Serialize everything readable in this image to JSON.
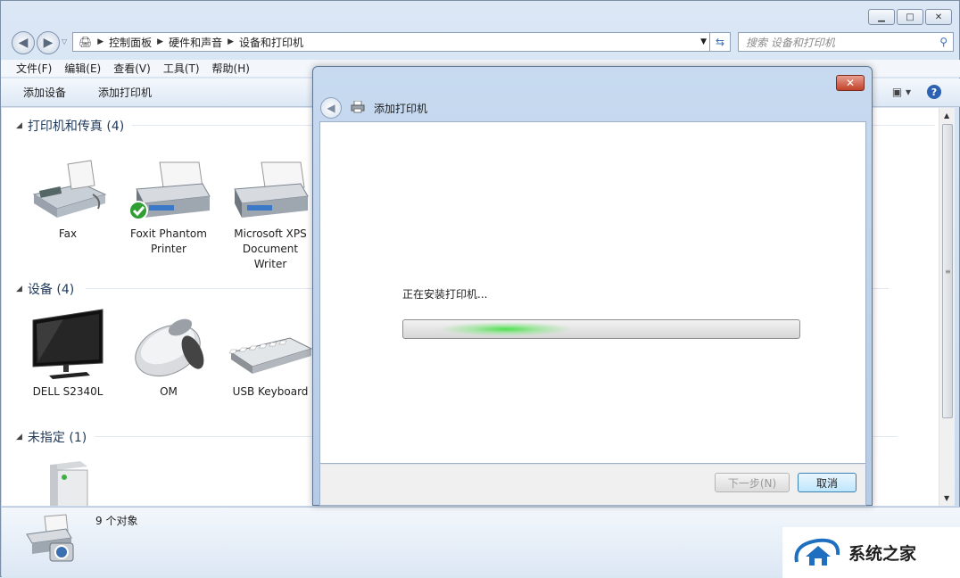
{
  "window": {
    "caption_buttons": [
      "minimize",
      "maximize",
      "close"
    ]
  },
  "nav": {
    "breadcrumb": [
      "控制面板",
      "硬件和声音",
      "设备和打印机"
    ],
    "search_placeholder": "搜索 设备和打印机"
  },
  "menu": [
    "文件(F)",
    "编辑(E)",
    "查看(V)",
    "工具(T)",
    "帮助(H)"
  ],
  "toolbar": {
    "add_device": "添加设备",
    "add_printer": "添加打印机"
  },
  "groups": {
    "printers": {
      "title": "打印机和传真 (4)",
      "items": [
        {
          "label_lines": [
            "Fax"
          ]
        },
        {
          "label_lines": [
            "Foxit Phantom",
            "Printer"
          ]
        },
        {
          "label_lines": [
            "Microsoft XPS",
            "Document",
            "Writer"
          ]
        }
      ]
    },
    "devices": {
      "title": "设备 (4)",
      "items": [
        {
          "label_lines": [
            "DELL S2340L"
          ]
        },
        {
          "label_lines": [
            "OM"
          ]
        },
        {
          "label_lines": [
            "USB Keyboard"
          ]
        }
      ]
    },
    "unspecified": {
      "title": "未指定 (1)"
    }
  },
  "status": {
    "count": "9 个对象"
  },
  "dialog": {
    "title": "添加打印机",
    "installing_text": "正在安装打印机...",
    "next_button": "下一步(N)",
    "cancel_button": "取消"
  },
  "watermark": {
    "text": "系统之家"
  },
  "colors": {
    "accent": "#2d62b3",
    "progress_glow": "#4fe04f",
    "close_red": "#c2422a"
  }
}
